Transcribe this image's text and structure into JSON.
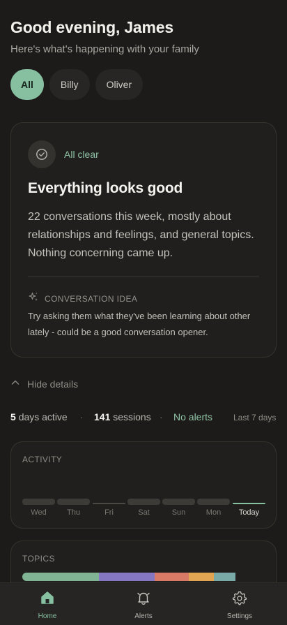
{
  "header": {
    "greeting": "Good evening, James",
    "subtitle": "Here's what's happening with your family"
  },
  "filters": {
    "selected": "All",
    "items": [
      "All",
      "Billy",
      "Oliver"
    ]
  },
  "summary": {
    "status_icon": "check-circle-icon",
    "status": "All clear",
    "title": "Everything looks good",
    "body": "22 conversations this week, mostly about relationships and feelings, and general topics. Nothing concerning came up.",
    "idea_icon": "sparkle-icon",
    "idea_label": "CONVERSATION IDEA",
    "idea_text": "Try asking them what they've been learning about other lately - could be a good conversation opener."
  },
  "details_toggle": {
    "icon": "chevron-up-icon",
    "label": "Hide details"
  },
  "stats": {
    "days_active_value": "5",
    "days_active_label": "days active",
    "sessions_value": "141",
    "sessions_label": "sessions",
    "separator": "·",
    "alerts": "No alerts",
    "range": "Last 7 days"
  },
  "activity": {
    "label": "ACTIVITY",
    "days": [
      {
        "day": "Wed",
        "level": "low"
      },
      {
        "day": "Thu",
        "level": "low"
      },
      {
        "day": "Fri",
        "level": "none"
      },
      {
        "day": "Sat",
        "level": "low"
      },
      {
        "day": "Sun",
        "level": "low"
      },
      {
        "day": "Mon",
        "level": "low"
      },
      {
        "day": "Today",
        "level": "none",
        "highlight": true
      }
    ]
  },
  "topics": {
    "label": "TOPICS",
    "segments": [
      {
        "color": "#7fb394",
        "share": 0.36
      },
      {
        "color": "#8577c2",
        "share": 0.26
      },
      {
        "color": "#d97a67",
        "share": 0.16
      },
      {
        "color": "#e0a453",
        "share": 0.12
      },
      {
        "color": "#79aaa8",
        "share": 0.1
      }
    ]
  },
  "colors": {
    "accent": "#86c0a0",
    "background": "#1c1b19",
    "card": "#201f1d"
  },
  "tabbar": {
    "active": "Home",
    "items": [
      {
        "label": "Home",
        "icon": "home-icon"
      },
      {
        "label": "Alerts",
        "icon": "bell-icon"
      },
      {
        "label": "Settings",
        "icon": "gear-icon"
      }
    ]
  }
}
